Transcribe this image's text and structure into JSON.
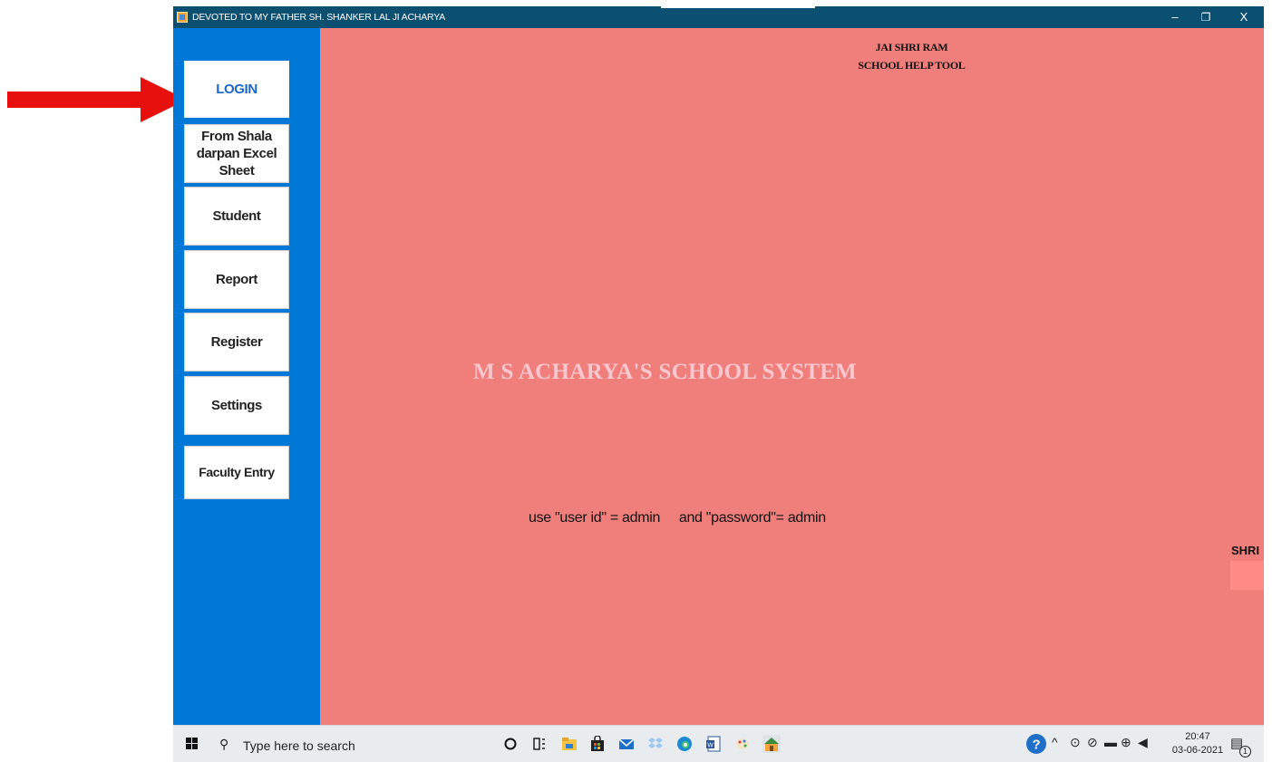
{
  "window": {
    "title": "DEVOTED TO MY FATHER SH. SHANKER LAL JI  ACHARYA",
    "controls": {
      "minimize": "–",
      "restore": "❐",
      "close": "X"
    }
  },
  "sidebar": {
    "items": [
      {
        "label": "LOGIN"
      },
      {
        "label": "From Shala darpan Excel Sheet"
      },
      {
        "label": "Student"
      },
      {
        "label": "Report"
      },
      {
        "label": "Register"
      },
      {
        "label": "Settings"
      },
      {
        "label": "Faculty Entry"
      }
    ]
  },
  "main": {
    "header_line1": "JAI SHRI RAM",
    "header_line2": "SCHOOL HELP TOOL",
    "brand_title": "M S ACHARYA'S SCHOOL SYSTEM",
    "hint": "use \"user id\" = admin     and \"password\"= admin",
    "side_label": "SHRI"
  },
  "taskbar": {
    "search_placeholder": "Type here to search",
    "time": "20:47",
    "date": "03-06-2021",
    "notification_count": "1"
  },
  "annotation": {
    "arrow_color": "#e8100c"
  },
  "colors": {
    "titlebar": "#0b4f71",
    "sidebar": "#0078d7",
    "main": "#f07f7c",
    "brand_text": "#f9c7cd",
    "active_nav_text": "#1a66c9"
  }
}
